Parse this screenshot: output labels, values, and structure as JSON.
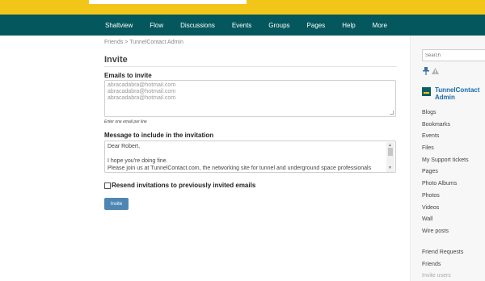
{
  "nav": {
    "items": [
      "Shaltview",
      "Flow",
      "Discussions",
      "Events",
      "Groups",
      "Pages",
      "Help",
      "More"
    ]
  },
  "breadcrumb": "Friends > TunnelContact Admin",
  "page_title": "Invite",
  "emails": {
    "label": "Emails to invite",
    "lines": [
      "abracadabra@hotmail.com",
      "abracadabra@hotmail.com",
      "abracadabra@hotmail.com"
    ],
    "hint": "Enter one email per line"
  },
  "message": {
    "label": "Message to include in the invitation",
    "lines": [
      "Dear Robert,",
      "",
      "I hope you're doing fine.",
      "Please join us at TunnelContact.com, the networking site for tunnel and underground space professionals"
    ]
  },
  "resend_label": "Resend invitations to previously invited emails",
  "invite_button_label": "Invite",
  "sidebar": {
    "search_placeholder": "Search",
    "owner_name": "TunnelContact Admin",
    "menu": [
      "Blogs",
      "Bookmarks",
      "Events",
      "Files",
      "My Support tickets",
      "Pages",
      "Photo Albums",
      "Photos",
      "Videos",
      "Wall",
      "Wire posts"
    ],
    "menu2": [
      "Friend Requests",
      "Friends",
      "Invite users"
    ]
  },
  "colors": {
    "top_strip": "#f2c618",
    "navbar": "#03575d",
    "button": "#4e86b3",
    "link": "#1a6aa6"
  },
  "icons": [
    "pin-icon",
    "warning-icon",
    "avatar"
  ]
}
